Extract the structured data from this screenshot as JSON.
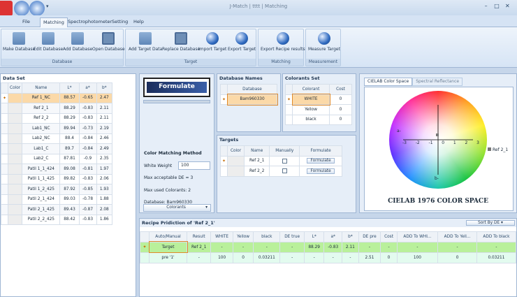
{
  "app": {
    "title": "J-Match | tttt | Matching"
  },
  "window_controls": [
    "–",
    "□",
    "✕"
  ],
  "menu_tabs": [
    "File",
    "Matching",
    "Spectrophotometer",
    "Setting",
    "Help"
  ],
  "ribbon": {
    "database": {
      "label": "Database",
      "buttons": [
        "Make Database",
        "Edit Database",
        "Add Database",
        "Open Database"
      ]
    },
    "target": {
      "label": "Target",
      "buttons": [
        "Add Target Data",
        "Replace Database",
        "Import Target",
        "Export Target"
      ]
    },
    "matching": {
      "label": "Matching",
      "buttons": [
        "Export Recipe results"
      ]
    },
    "measurement": {
      "label": "Measurement",
      "buttons": [
        "Measure Target"
      ]
    }
  },
  "dataset": {
    "title": "Data Set",
    "columns": [
      "Color",
      "Name",
      "L*",
      "a*",
      "b*"
    ],
    "rows": [
      {
        "name": "Ref 1_NC",
        "L": "88.57",
        "a": "-0.65",
        "b": "2.47"
      },
      {
        "name": "Ref 2_1",
        "L": "88.29",
        "a": "-0.83",
        "b": "2.11"
      },
      {
        "name": "Ref 2_2",
        "L": "88.29",
        "a": "-0.83",
        "b": "2.11"
      },
      {
        "name": "Lab1_NC",
        "L": "89.94",
        "a": "-0.73",
        "b": "2.19"
      },
      {
        "name": "Lab2_NC",
        "L": "88.4",
        "a": "-0.84",
        "b": "2.46"
      },
      {
        "name": "Lab1_C",
        "L": "89.7",
        "a": "-0.84",
        "b": "2.49"
      },
      {
        "name": "Lab2_C",
        "L": "87.81",
        "a": "-0.9",
        "b": "2.35"
      },
      {
        "name": "Patil 1_1_424",
        "L": "89.08",
        "a": "-0.81",
        "b": "1.97"
      },
      {
        "name": "Patil 1_1_425",
        "L": "89.82",
        "a": "-0.83",
        "b": "2.06"
      },
      {
        "name": "Patil 1_2_425",
        "L": "87.92",
        "a": "-0.85",
        "b": "1.93"
      },
      {
        "name": "Patil 2_1_424",
        "L": "89.03",
        "a": "-0.78",
        "b": "1.88"
      },
      {
        "name": "Patil 2_1_425",
        "L": "89.43",
        "a": "-0.87",
        "b": "2.08"
      },
      {
        "name": "Patil 2_2_425",
        "L": "88.42",
        "a": "-0.83",
        "b": "1.86"
      }
    ]
  },
  "formulate": {
    "logo_text": "Formulate",
    "method_title": "Color Matching Method",
    "white_weight_label": "White Weight",
    "white_weight_value": "100",
    "max_de": "Max acceptable DE = 3",
    "max_colorants": "Max used Colorants: 2",
    "database_line": "Database: Bam960330",
    "colorants_button": "Colorants"
  },
  "database_names": {
    "title": "Database Names",
    "column": "Database",
    "rows": [
      "Bam960330"
    ]
  },
  "colorants_set": {
    "title": "Colorants Set",
    "columns": [
      "Colorant",
      "Cost"
    ],
    "rows": [
      {
        "name": "WHITE",
        "cost": "0"
      },
      {
        "name": "Yellow",
        "cost": "0"
      },
      {
        "name": "black",
        "cost": "0"
      }
    ]
  },
  "targets": {
    "title": "Targets",
    "columns": [
      "Color",
      "Name",
      "Manually",
      "Formulate"
    ],
    "rows": [
      {
        "name": "Ref 2_1",
        "button": "Formulate"
      },
      {
        "name": "Ref 2_2",
        "button": "Formulate"
      }
    ]
  },
  "cielab": {
    "tabs": [
      "CIELAB Color Space",
      "Spectral Reflectance"
    ],
    "caption": "CIELAB 1976 COLOR SPACE",
    "point_label": "Ref 2_1",
    "axis_labels": {
      "a_minus": "a-",
      "b_minus": "b-"
    },
    "ticks": [
      "-3",
      "-2",
      "-1",
      "0",
      "1",
      "2",
      "3"
    ]
  },
  "recipe": {
    "title": "Recipe Pridiction of 'Ref 2_1'",
    "sort_label": "Sort By DE",
    "columns": [
      "Auto/Manual",
      "Result",
      "WHITE",
      "Yellow",
      "black",
      "DE true",
      "L*",
      "a*",
      "b*",
      "DE pre",
      "Cost",
      "ADD To WHI...",
      "ADD To Yell...",
      "ADD To black"
    ],
    "target_row": [
      "Target",
      "Ref 2_1",
      "-",
      "-",
      "-",
      "-",
      "88.29",
      "-0.83",
      "2.11",
      "-",
      "-",
      "-",
      "-",
      "-"
    ],
    "pre_row": [
      "pre '1'",
      "-",
      "100",
      "0",
      "0.03211",
      "-",
      "-",
      "-",
      "-",
      "2.51",
      "0",
      "100",
      "0",
      "0.03211"
    ]
  }
}
